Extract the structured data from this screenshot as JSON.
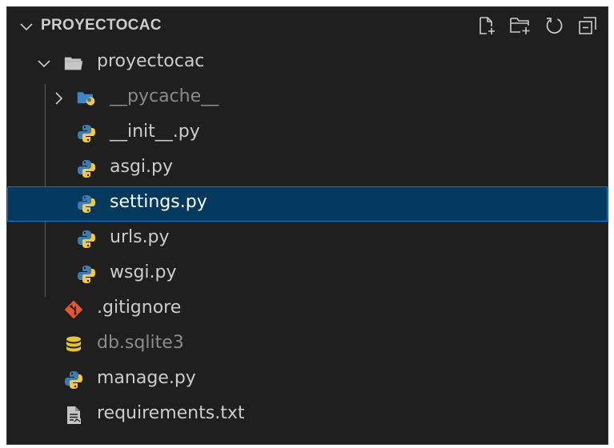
{
  "explorer": {
    "title": "PROYECTOCAC",
    "actions": [
      {
        "name": "new-file",
        "icon": "new-file-icon"
      },
      {
        "name": "new-folder",
        "icon": "new-folder-icon"
      },
      {
        "name": "refresh",
        "icon": "refresh-icon"
      },
      {
        "name": "collapse-all",
        "icon": "collapse-all-icon"
      }
    ]
  },
  "tree": {
    "items": [
      {
        "label": "proyectocac",
        "icon": "folder-open-icon",
        "twisty": "expanded"
      },
      {
        "label": "__pycache__",
        "icon": "python-folder-icon",
        "twisty": "collapsed",
        "dimmed": true
      },
      {
        "label": "__init__.py",
        "icon": "python-icon"
      },
      {
        "label": "asgi.py",
        "icon": "python-icon"
      },
      {
        "label": "settings.py",
        "icon": "python-icon",
        "selected": true
      },
      {
        "label": "urls.py",
        "icon": "python-icon"
      },
      {
        "label": "wsgi.py",
        "icon": "python-icon"
      },
      {
        "label": ".gitignore",
        "icon": "git-icon"
      },
      {
        "label": "db.sqlite3",
        "icon": "database-icon",
        "dimmed": true
      },
      {
        "label": "manage.py",
        "icon": "python-icon"
      },
      {
        "label": "requirements.txt",
        "icon": "text-file-icon"
      }
    ]
  },
  "colors": {
    "background": "#1f1f1f",
    "selected_bg": "#04395e",
    "selected_border": "#0078d4",
    "python_blue": "#3e7cb0",
    "python_yellow": "#f7c844",
    "git_orange": "#e4572e",
    "db_yellow": "#e8c33a"
  }
}
